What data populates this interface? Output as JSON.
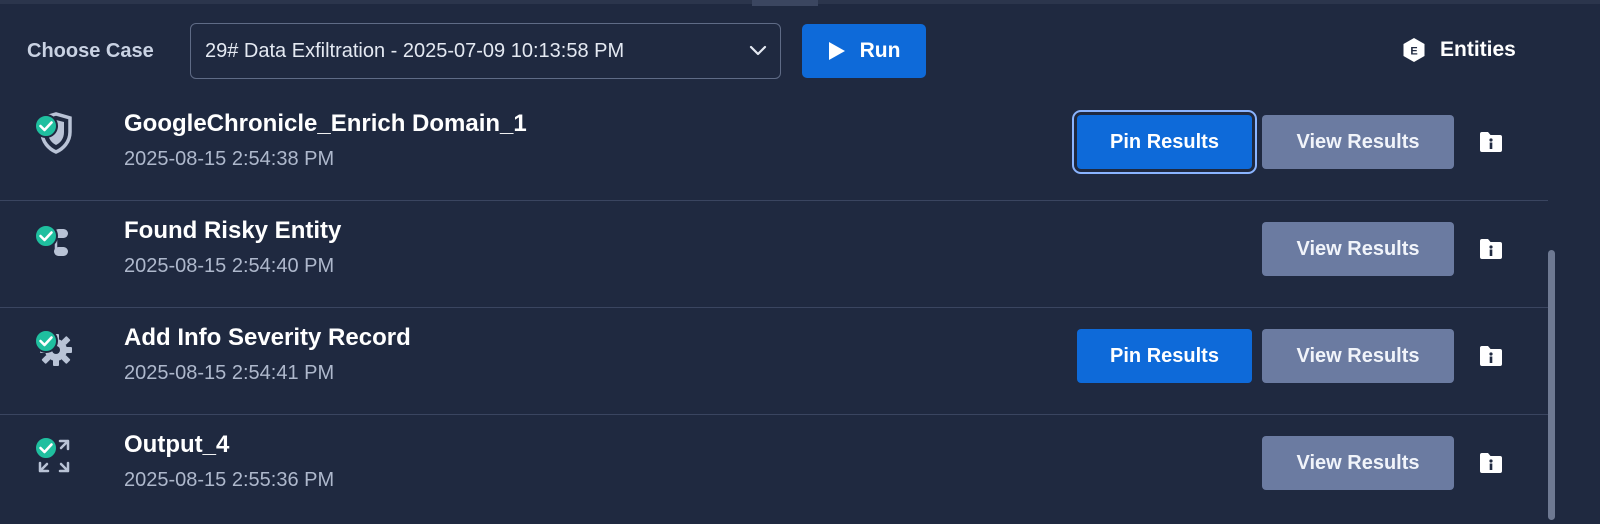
{
  "toolbar": {
    "choose_label": "Choose Case",
    "case_value": "29# Data Exfiltration - 2025-07-09 10:13:58 PM",
    "run_label": "Run",
    "entities_label": "Entities",
    "entities_badge": "E"
  },
  "steps": [
    {
      "title": "GoogleChronicle_Enrich Domain_1",
      "time": "2025-08-15 2:54:38 PM",
      "icon": "shield-check-icon",
      "pin_label": "Pin Results",
      "view_label": "View Results"
    },
    {
      "title": "Found Risky Entity",
      "time": "2025-08-15 2:54:40 PM",
      "icon": "flow-check-icon",
      "view_label": "View Results"
    },
    {
      "title": "Add Info Severity Record",
      "time": "2025-08-15 2:54:41 PM",
      "icon": "gear-check-icon",
      "pin_label": "Pin Results",
      "view_label": "View Results"
    },
    {
      "title": "Output_4",
      "time": "2025-08-15 2:55:36 PM",
      "icon": "expand-check-icon",
      "view_label": "View Results"
    }
  ],
  "colors": {
    "background": "#1f2940",
    "primary": "#0e6ad9",
    "secondary_button": "#6b7ba1",
    "success": "#1fbf9f"
  }
}
